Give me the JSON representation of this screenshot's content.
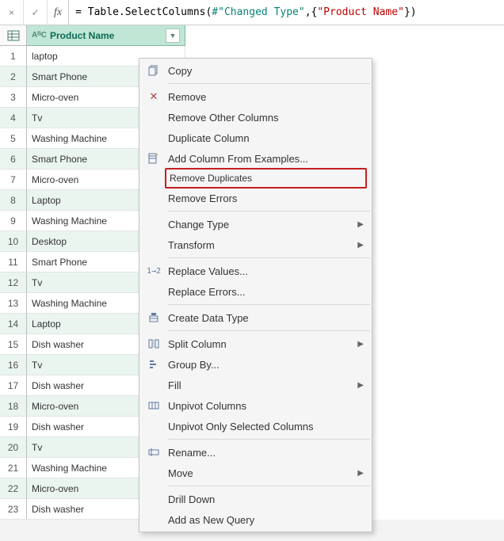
{
  "formula_bar": {
    "cancel_icon": "×",
    "accept_icon": "✓",
    "fx_label": "fx",
    "formula_prefix": "= Table.SelectColumns(",
    "formula_ref": "#\"Changed Type\"",
    "formula_mid": ",{",
    "formula_str": "\"Product Name\"",
    "formula_suffix": "})"
  },
  "column": {
    "type_icon": "AᴮC",
    "header": "Product Name"
  },
  "rows": [
    "laptop",
    "Smart Phone",
    "Micro-oven",
    "Tv",
    "Washing Machine",
    "Smart Phone",
    "Micro-oven",
    "Laptop",
    "Washing Machine",
    "Desktop",
    "Smart Phone",
    "Tv",
    "Washing Machine",
    "Laptop",
    "Dish washer",
    "Tv",
    "Dish washer",
    "Micro-oven",
    "Dish washer",
    "Tv",
    "Washing Machine",
    "Micro-oven",
    "Dish washer"
  ],
  "menu": {
    "copy": "Copy",
    "remove": "Remove",
    "remove_other": "Remove Other Columns",
    "duplicate": "Duplicate Column",
    "add_from_examples": "Add Column From Examples...",
    "remove_duplicates": "Remove Duplicates",
    "remove_errors": "Remove Errors",
    "change_type": "Change Type",
    "transform": "Transform",
    "replace_values": "Replace Values...",
    "replace_errors": "Replace Errors...",
    "create_data_type": "Create Data Type",
    "split_column": "Split Column",
    "group_by": "Group By...",
    "fill": "Fill",
    "unpivot": "Unpivot Columns",
    "unpivot_selected": "Unpivot Only Selected Columns",
    "rename": "Rename...",
    "move": "Move",
    "drill_down": "Drill Down",
    "add_as_query": "Add as New Query"
  }
}
